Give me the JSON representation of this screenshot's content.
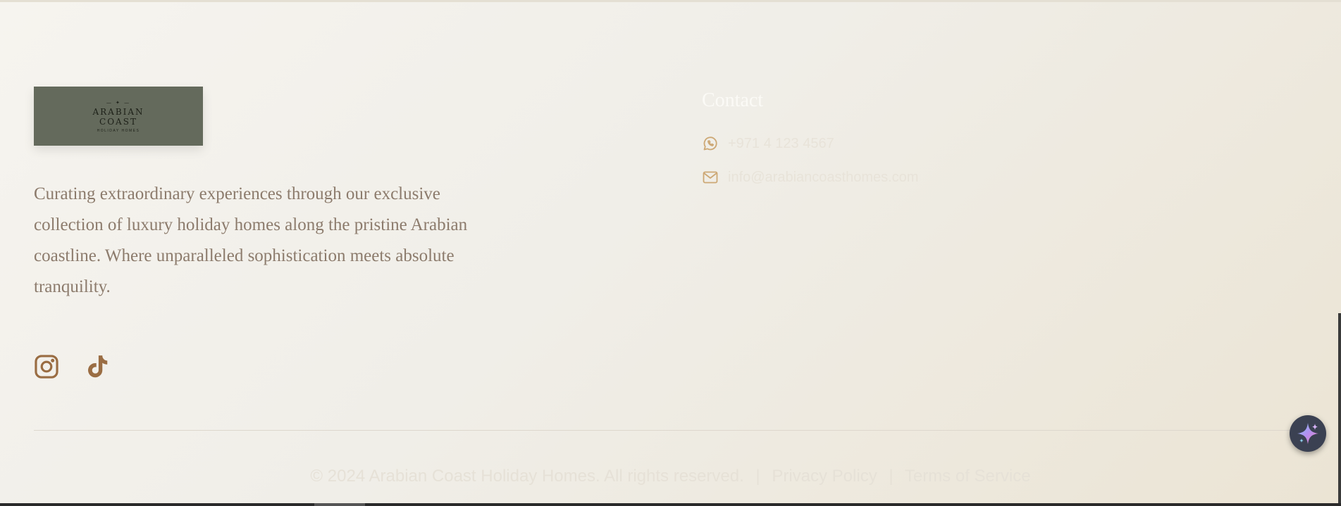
{
  "brand": {
    "logo_line1": "ARABIAN",
    "logo_line2": "COAST",
    "logo_line3": "HOLIDAY HOMES",
    "logo_mark": "— ✦ —"
  },
  "description": "Curating extraordinary experiences through our exclusive collection of luxury holiday homes along the pristine Arabian coastline. Where unparalleled sophistication meets absolute tranquility.",
  "social": [
    {
      "icon": "instagram-icon"
    },
    {
      "icon": "tiktok-icon"
    }
  ],
  "contact": {
    "title": "Contact",
    "phone": "+971 4 123 4567",
    "email": "info@arabiancoasthomes.com"
  },
  "bottom": {
    "copyright": "© 2024 Arabian Coast Holiday Homes. All rights reserved.",
    "separator": "|",
    "privacy": "Privacy Policy",
    "terms": "Terms of Service"
  },
  "colors": {
    "accent": "#9a6d43",
    "contact_icon": "#cda875",
    "description_text": "#8c7b6c",
    "logo_bg": "#646a5c"
  }
}
